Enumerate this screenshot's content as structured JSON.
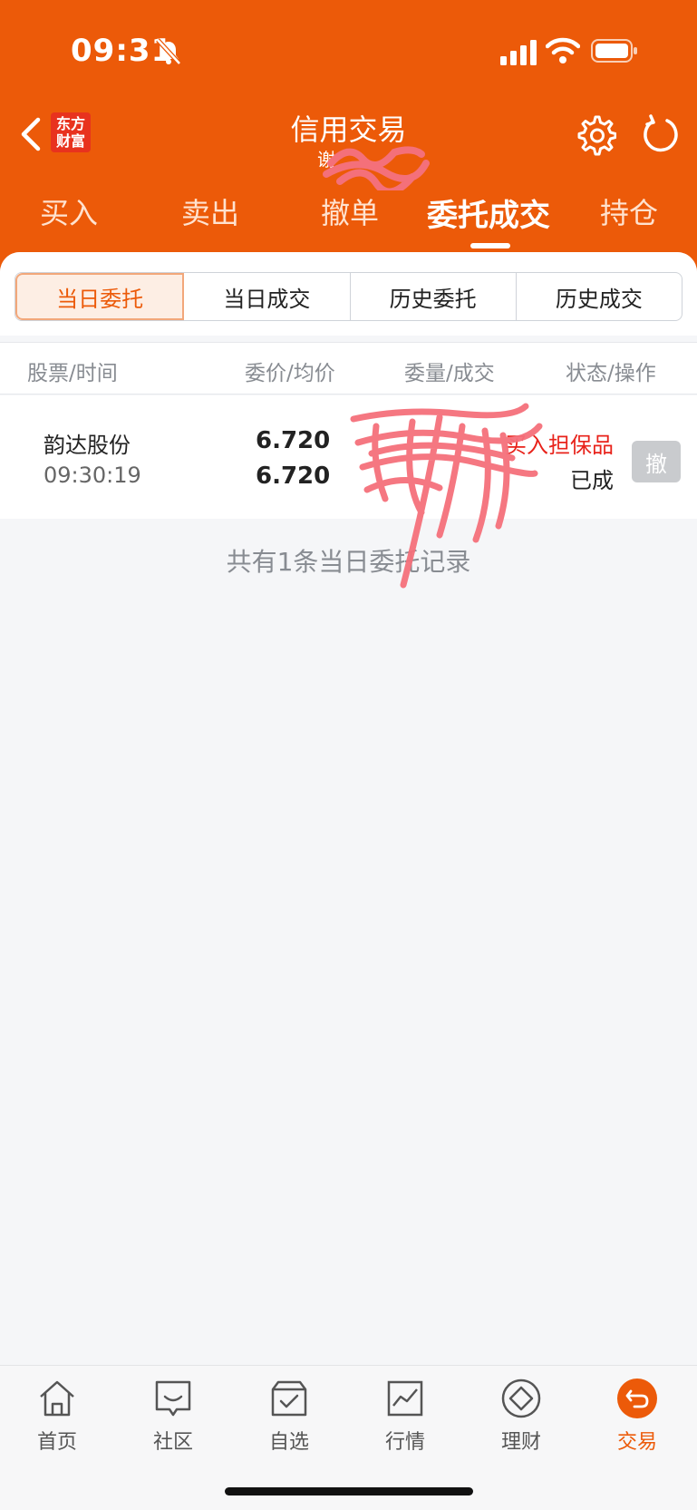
{
  "status_bar": {
    "time": "09:31"
  },
  "header": {
    "logo_line1": "东方",
    "logo_line2": "财富",
    "title": "信用交易",
    "subtitle": "谢"
  },
  "tabs": [
    {
      "label": "买入"
    },
    {
      "label": "卖出"
    },
    {
      "label": "撤单"
    },
    {
      "label": "委托成交",
      "active": true
    },
    {
      "label": "持仓"
    }
  ],
  "segments": [
    {
      "label": "当日委托",
      "active": true
    },
    {
      "label": "当日成交"
    },
    {
      "label": "历史委托"
    },
    {
      "label": "历史成交"
    }
  ],
  "table": {
    "headers": [
      "股票/时间",
      "委价/均价",
      "委量/成交",
      "状态/操作"
    ],
    "rows": [
      {
        "name": "韵达股份",
        "time": "09:30:19",
        "order_price": "6.720",
        "avg_price": "6.720",
        "type": "买入担保品",
        "state": "已成",
        "action": "撤"
      }
    ]
  },
  "summary": "共有1条当日委托记录",
  "bottom_nav": [
    {
      "label": "首页",
      "icon": "home-icon"
    },
    {
      "label": "社区",
      "icon": "chat-icon"
    },
    {
      "label": "自选",
      "icon": "watchlist-icon"
    },
    {
      "label": "行情",
      "icon": "chart-icon"
    },
    {
      "label": "理财",
      "icon": "diamond-icon"
    },
    {
      "label": "交易",
      "icon": "trade-icon",
      "active": true
    }
  ],
  "colors": {
    "brand": "#ec5a09",
    "alert_red": "#e8221a"
  }
}
